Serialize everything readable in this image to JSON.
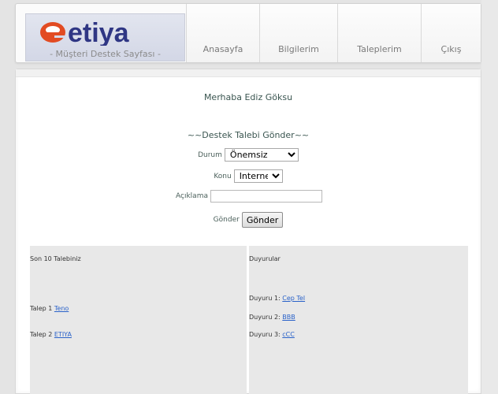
{
  "brand": {
    "logo_text": "etiya",
    "tagline": "- Müşteri Destek Sayfası -",
    "colors": {
      "logo_e": "#e24b22",
      "logo_text": "#2f3684"
    }
  },
  "nav": [
    {
      "label": "Anasayfa"
    },
    {
      "label": "Bilgilerim"
    },
    {
      "label": "Taleplerim"
    },
    {
      "label": "Çıkış"
    }
  ],
  "greeting": "Merhaba Ediz Göksu",
  "form": {
    "title": "~~Destek Talebi Gönder~~",
    "durum_label": "Durum",
    "durum_value": "Önemsiz",
    "konu_label": "Konu",
    "konu_value": "Internet",
    "aciklama_label": "Açıklama",
    "aciklama_value": "",
    "gonder_label": "Gönder",
    "gonder_button": "Gönder"
  },
  "requests": {
    "title": "Son 10 Talebiniz",
    "items": [
      {
        "prefix": "Talep 1",
        "link": "Teno"
      },
      {
        "prefix": "Talep 2",
        "link": "ETIYA"
      }
    ]
  },
  "announcements": {
    "title": "Duyurular",
    "items": [
      {
        "prefix": "Duyuru 1:",
        "link": "Cep Tel"
      },
      {
        "prefix": "Duyuru 2:",
        "link": "BBB"
      },
      {
        "prefix": "Duyuru 3:",
        "link": "cCC"
      }
    ]
  }
}
